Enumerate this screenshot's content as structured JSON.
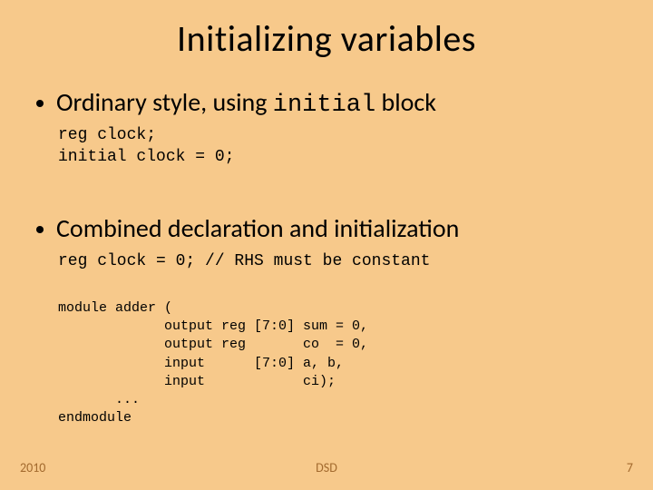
{
  "title": "Initializing variables",
  "bullets": [
    {
      "pre": "Ordinary style, using ",
      "mono": "initial",
      "post": " block"
    },
    {
      "pre": "Combined declaration and initialization",
      "mono": "",
      "post": ""
    }
  ],
  "code1": "reg clock;\ninitial clock = 0;",
  "code2": "reg clock = 0; // RHS must be constant",
  "code3": "module adder (\n             output reg [7:0] sum = 0,\n             output reg       co  = 0,\n             input      [7:0] a, b,\n             input            ci);\n       ...\nendmodule",
  "footer": {
    "left": "2010",
    "center": "DSD",
    "right": "7"
  }
}
